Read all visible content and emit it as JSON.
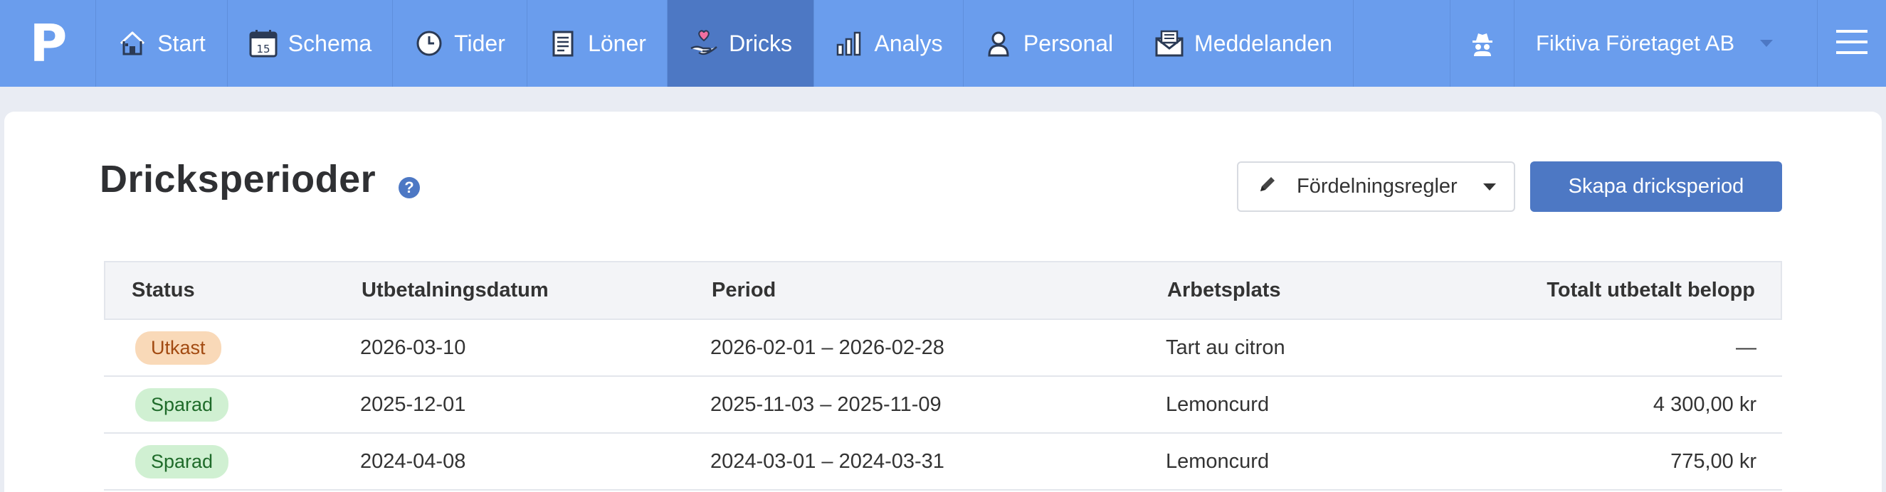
{
  "nav": {
    "logo": "P",
    "items": [
      {
        "label": "Start",
        "icon": "home-icon"
      },
      {
        "label": "Schema",
        "icon": "calendar-icon",
        "calendar_day": "15"
      },
      {
        "label": "Tider",
        "icon": "clock-icon"
      },
      {
        "label": "Löner",
        "icon": "payslip-icon"
      },
      {
        "label": "Dricks",
        "icon": "tip-heart-hand-icon",
        "active": true
      },
      {
        "label": "Analys",
        "icon": "bar-chart-icon"
      },
      {
        "label": "Personal",
        "icon": "person-icon"
      },
      {
        "label": "Meddelanden",
        "icon": "envelope-icon"
      }
    ],
    "spy_icon": "incognito-icon",
    "company": "Fiktiva Företaget AB",
    "menu_icon": "hamburger-icon"
  },
  "page": {
    "title": "Dricksperioder",
    "help_icon": "question-circle-icon",
    "rules_button": "Fördelningsregler",
    "create_button": "Skapa dricksperiod"
  },
  "table": {
    "headers": {
      "status": "Status",
      "date": "Utbetalningsdatum",
      "period": "Period",
      "place": "Arbetsplats",
      "amount": "Totalt utbetalt belopp"
    },
    "rows": [
      {
        "status": "Utkast",
        "date": "2026-03-10",
        "period": "2026-02-01 – 2026-02-28",
        "place": "Tart au citron",
        "amount": "—"
      },
      {
        "status": "Sparad",
        "date": "2025-12-01",
        "period": "2025-11-03 – 2025-11-09",
        "place": "Lemoncurd",
        "amount": "4 300,00 kr"
      },
      {
        "status": "Sparad",
        "date": "2024-04-08",
        "period": "2024-03-01 – 2024-03-31",
        "place": "Lemoncurd",
        "amount": "775,00 kr"
      }
    ]
  },
  "colors": {
    "nav_bg": "#6a9ded",
    "nav_active": "#4d78c4",
    "primary": "#4d78c4",
    "draft_badge_bg": "#f9d9b8",
    "saved_badge_bg": "#d0f0d2"
  }
}
